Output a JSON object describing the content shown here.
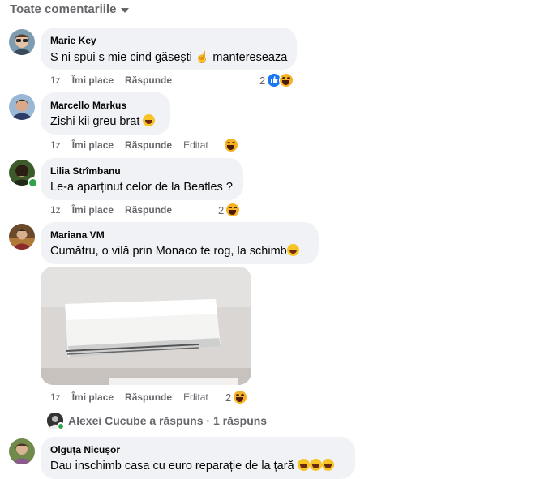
{
  "sort": {
    "label": "Toate comentariile"
  },
  "comments": [
    {
      "author": "Marie Key",
      "text_before": "S ni spui s mie cind găsești ",
      "text_after": " mantereseaza",
      "time": "1z",
      "like_label": "Îmi place",
      "reply_label": "Răspunde",
      "reaction_count": "2",
      "reaction_icons": [
        "like-icon",
        "haha-icon"
      ]
    },
    {
      "author": "Marcello Markus",
      "text": "Zishi kii greu brat",
      "time": "1z",
      "like_label": "Îmi place",
      "reply_label": "Răspunde",
      "edited_label": "Editat",
      "reaction_icons": [
        "haha-icon"
      ]
    },
    {
      "author": "Lilia Strîmbanu",
      "text": "Le-a aparținut celor de la Beatles ?",
      "time": "1z",
      "like_label": "Îmi place",
      "reply_label": "Răspunde",
      "reaction_count": "2",
      "reaction_icons": [
        "haha-icon"
      ]
    },
    {
      "author": "Mariana VM",
      "text": "Cumătru, o vilă prin Monaco te rog, la schimb",
      "time": "1z",
      "like_label": "Îmi place",
      "reply_label": "Răspunde",
      "edited_label": "Editat",
      "reaction_count": "2",
      "reaction_icons": [
        "haha-icon"
      ]
    },
    {
      "author": "Olguța Nicușor",
      "text": "Dau inschimb casa cu euro reparație de la țară"
    }
  ],
  "replies": {
    "label": "Alexei Cucube a răspuns · 1 răspuns"
  },
  "colors": {
    "bubble": "#f0f2f5",
    "secondary_text": "#65676b",
    "like_blue": "#1877f2",
    "online_green": "#31a24c"
  }
}
